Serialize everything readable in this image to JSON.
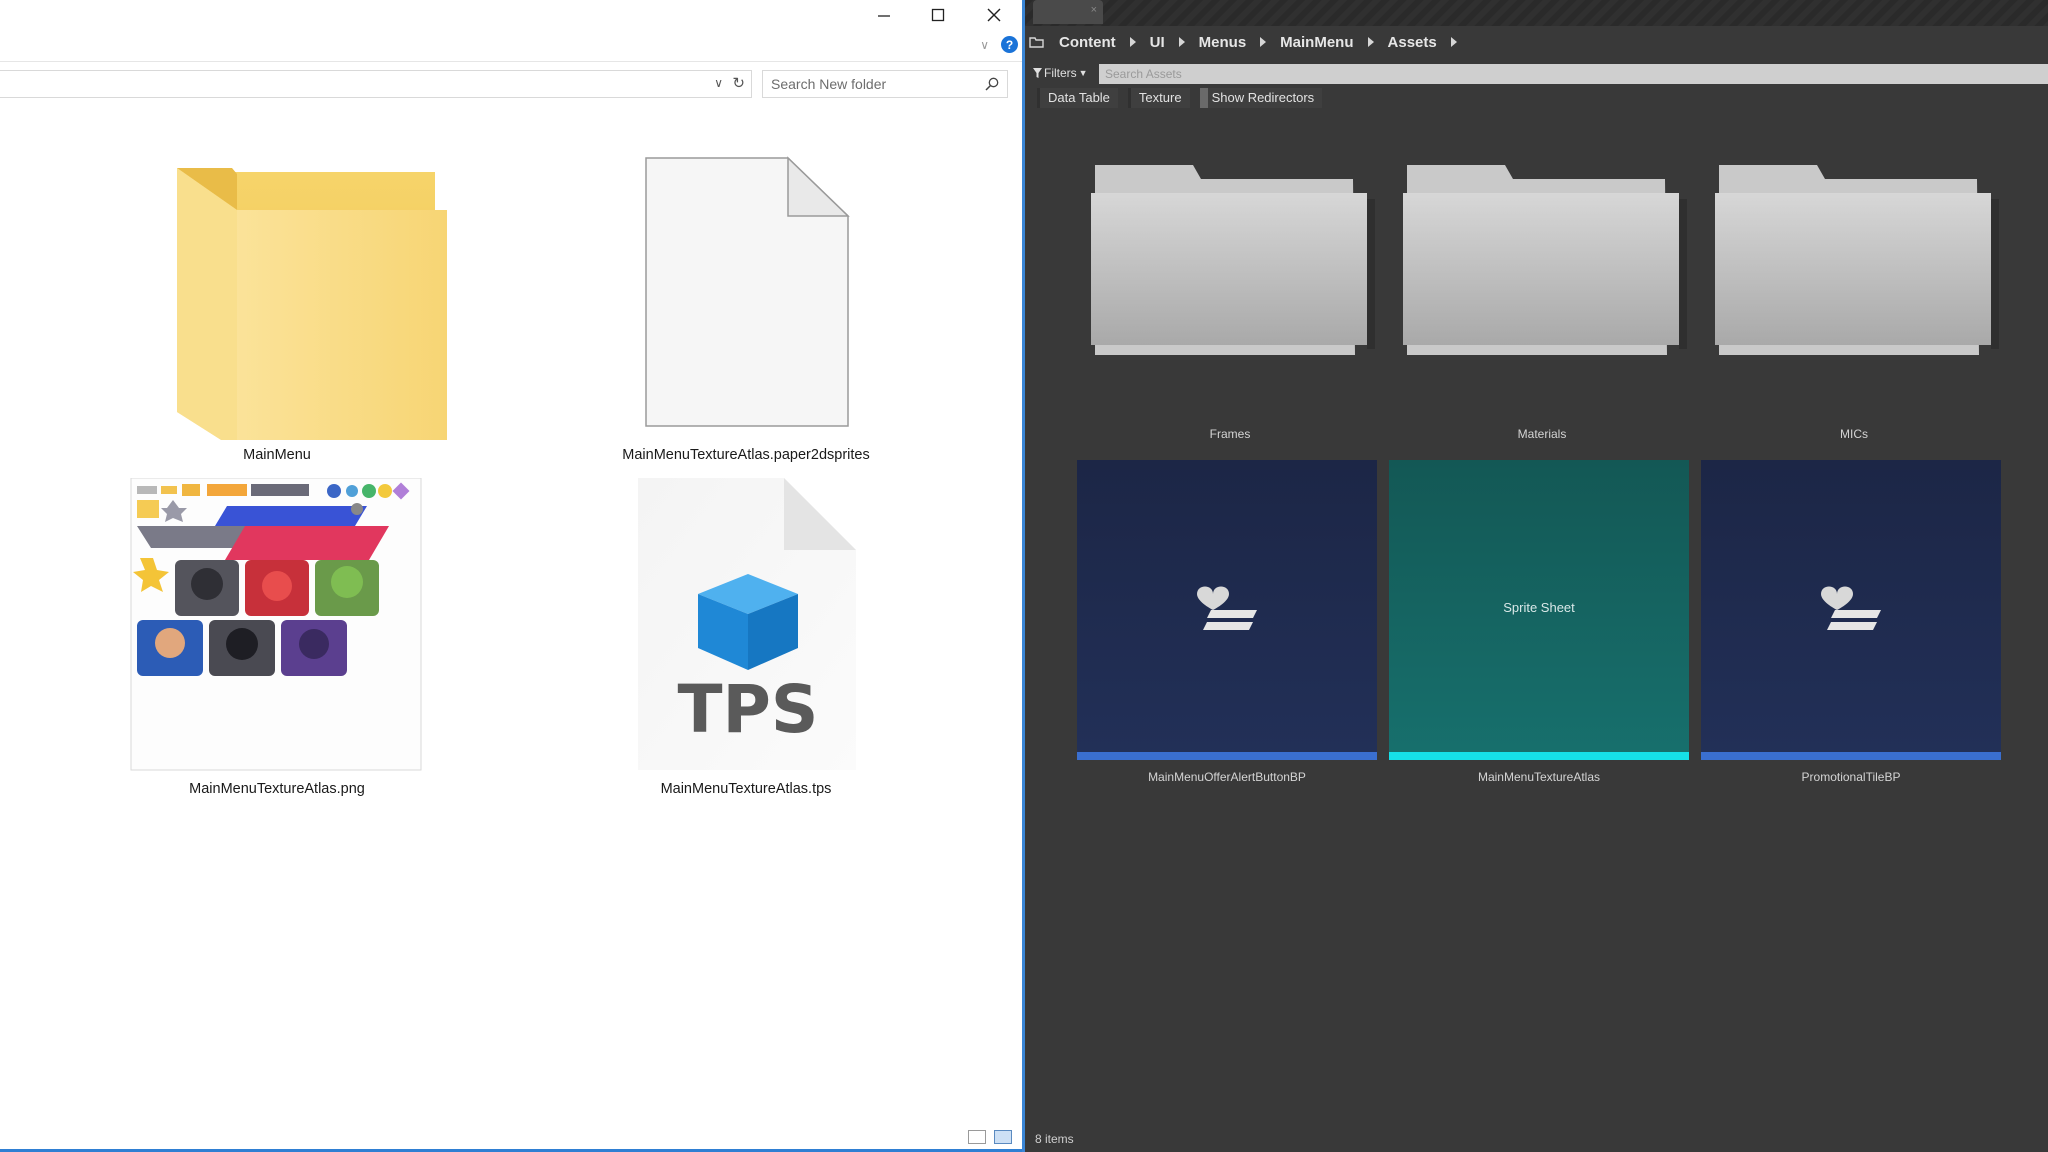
{
  "explorer": {
    "window_buttons": {
      "minimize": "minimize",
      "maximize": "maximize",
      "close": "close"
    },
    "search": {
      "placeholder": "Search New folder"
    },
    "items": [
      {
        "label": "MainMenu",
        "kind": "folder"
      },
      {
        "label": "MainMenuTextureAtlas.paper2dsprites",
        "kind": "blank-file"
      },
      {
        "label": "MainMenuTextureAtlas.png",
        "kind": "image"
      },
      {
        "label": "MainMenuTextureAtlas.tps",
        "kind": "tps-file"
      }
    ],
    "tps_icon_text": "TPS",
    "colors": {
      "folder": "#f7d774",
      "accent": "#2f7fd3",
      "tps_cube": "#1f88d6"
    }
  },
  "content_browser": {
    "breadcrumb": [
      "Content",
      "UI",
      "Menus",
      "MainMenu",
      "Assets"
    ],
    "filters_label": "Filters",
    "search": {
      "placeholder": "Search Assets"
    },
    "filter_chips": [
      "Data Table",
      "Texture",
      "Show Redirectors"
    ],
    "folders": [
      "Frames",
      "Materials",
      "MICs"
    ],
    "assets": [
      {
        "label": "MainMenuOfferAlertButtonBP",
        "type": "blueprint",
        "bar_color": "#3a6fd0",
        "bg": "#1f2a4a"
      },
      {
        "label": "MainMenuTextureAtlas",
        "type": "sprite-sheet",
        "text": "Sprite Sheet",
        "bar_color": "#16e0e8",
        "bg": "#15605e"
      },
      {
        "label": "PromotionalTileBP",
        "type": "blueprint",
        "bar_color": "#3a6fd0",
        "bg": "#1f2a4a"
      }
    ],
    "item_count": "8 items"
  }
}
